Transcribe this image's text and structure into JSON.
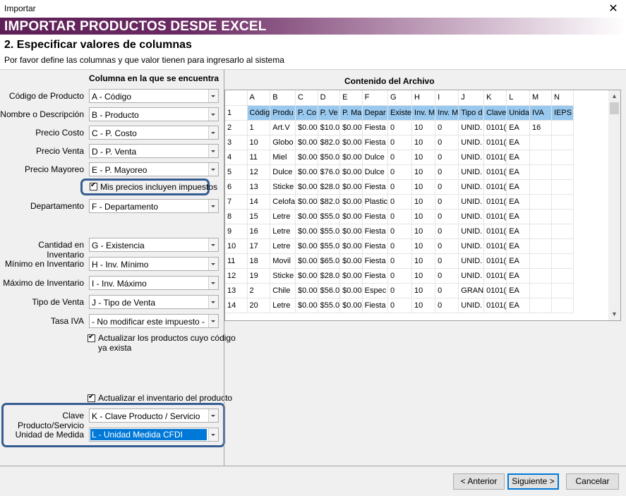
{
  "window": {
    "title": "Importar",
    "close_glyph": "✕"
  },
  "banner": {
    "title": "IMPORTAR PRODUCTOS DESDE EXCEL"
  },
  "step": {
    "title": "2. Especificar valores de columnas",
    "subtitle": "Por favor define las columnas y que valor tienen para ingresarlo al sistema"
  },
  "mapping": {
    "header": "Columna en la que se encuentra",
    "fields": [
      {
        "label": "Código de Producto",
        "value": "A - Código"
      },
      {
        "label": "Nombre o Descripción",
        "value": "B - Producto"
      },
      {
        "label": "Precio Costo",
        "value": "C - P. Costo"
      },
      {
        "label": "Precio Venta",
        "value": "D - P. Venta"
      },
      {
        "label": "Precio Mayoreo",
        "value": "E - P. Mayoreo"
      },
      {
        "label": "Departamento",
        "value": "F - Departamento"
      },
      {
        "label": "Cantidad en Inventario",
        "value": "G - Existencia"
      },
      {
        "label": "Mínimo en Inventario",
        "value": "H - Inv. Mínimo"
      },
      {
        "label": "Máximo de Inventario",
        "value": "I - Inv. Máximo"
      },
      {
        "label": "Tipo de Venta",
        "value": "J - Tipo de Venta"
      },
      {
        "label": "Tasa IVA",
        "value": "- No modificar este impuesto -"
      },
      {
        "label": "Clave Producto/Servicio",
        "value": "K - Clave Producto / Servicio"
      },
      {
        "label": "Unidad de Medida",
        "value": "L - Unidad Medida CFDI"
      }
    ],
    "checkboxes": {
      "include_taxes": {
        "label": "Mis precios incluyen impuestos",
        "checked": true
      },
      "update_existing_line1": "Actualizar los productos cuyo código",
      "update_existing_line2": "ya exista",
      "update_existing_checked": true,
      "update_inventory": {
        "label": "Actualizar el inventario del producto",
        "checked": true
      }
    }
  },
  "file_contents": {
    "header": "Contenido del Archivo",
    "columns": [
      "",
      "A",
      "B",
      "C",
      "D",
      "E",
      "F",
      "G",
      "H",
      "I",
      "J",
      "K",
      "L",
      "M",
      "N"
    ],
    "rows": [
      [
        "1",
        "Códig",
        "Produ",
        "P. Co",
        "P. Ve",
        "P. Ma",
        "Depar",
        "Existe",
        "Inv. M",
        "Inv. M",
        "Tipo d",
        "Clave",
        "Unida",
        "IVA",
        "IEPS"
      ],
      [
        "2",
        "1",
        "Art.V",
        "$0.00",
        "$10.0",
        "$0.00",
        "Fiesta",
        "0",
        "10",
        "0",
        "UNID.",
        "0101(",
        "EA",
        "16",
        ""
      ],
      [
        "3",
        "10",
        "Globo",
        "$0.00",
        "$82.0",
        "$0.00",
        "Fiesta",
        "0",
        "10",
        "0",
        "UNID.",
        "0101(",
        "EA",
        "",
        ""
      ],
      [
        "4",
        "11",
        "Miel",
        "$0.00",
        "$50.0",
        "$0.00",
        "Dulce",
        "0",
        "10",
        "0",
        "UNID.",
        "0101(",
        "EA",
        "",
        ""
      ],
      [
        "5",
        "12",
        "Dulce",
        "$0.00",
        "$76.0",
        "$0.00",
        "Dulce",
        "0",
        "10",
        "0",
        "UNID.",
        "0101(",
        "EA",
        "",
        ""
      ],
      [
        "6",
        "13",
        "Sticke",
        "$0.00",
        "$28.0",
        "$0.00",
        "Fiesta",
        "0",
        "10",
        "0",
        "UNID.",
        "0101(",
        "EA",
        "",
        ""
      ],
      [
        "7",
        "14",
        "Celofa",
        "$0.00",
        "$82.0",
        "$0.00",
        "Plastic",
        "0",
        "10",
        "0",
        "UNID.",
        "0101(",
        "EA",
        "",
        ""
      ],
      [
        "8",
        "15",
        "Letre",
        "$0.00",
        "$55.0",
        "$0.00",
        "Fiesta",
        "0",
        "10",
        "0",
        "UNID.",
        "0101(",
        "EA",
        "",
        ""
      ],
      [
        "9",
        "16",
        "Letre",
        "$0.00",
        "$55.0",
        "$0.00",
        "Fiesta",
        "0",
        "10",
        "0",
        "UNID.",
        "0101(",
        "EA",
        "",
        ""
      ],
      [
        "10",
        "17",
        "Letre",
        "$0.00",
        "$55.0",
        "$0.00",
        "Fiesta",
        "0",
        "10",
        "0",
        "UNID.",
        "0101(",
        "EA",
        "",
        ""
      ],
      [
        "11",
        "18",
        "Movil",
        "$0.00",
        "$65.0",
        "$0.00",
        "Fiesta",
        "0",
        "10",
        "0",
        "UNID.",
        "0101(",
        "EA",
        "",
        ""
      ],
      [
        "12",
        "19",
        "Sticke",
        "$0.00",
        "$28.0",
        "$0.00",
        "Fiesta",
        "0",
        "10",
        "0",
        "UNID.",
        "0101(",
        "EA",
        "",
        ""
      ],
      [
        "13",
        "2",
        "Chile",
        "$0.00",
        "$56.0",
        "$0.00",
        "Espec",
        "0",
        "10",
        "0",
        "GRAN",
        "0101(",
        "EA",
        "",
        ""
      ],
      [
        "14",
        "20",
        "Letre",
        "$0.00",
        "$55.0",
        "$0.00",
        "Fiesta",
        "0",
        "10",
        "0",
        "UNID.",
        "0101(",
        "EA",
        "",
        ""
      ]
    ]
  },
  "buttons": {
    "back": "< Anterior",
    "next": "Siguiente >",
    "cancel": "Cancelar"
  },
  "colors": {
    "banner": "#5d1f56",
    "highlight_border": "#355d92",
    "selection": "#0078d7",
    "first_row": "#99c9ef"
  }
}
